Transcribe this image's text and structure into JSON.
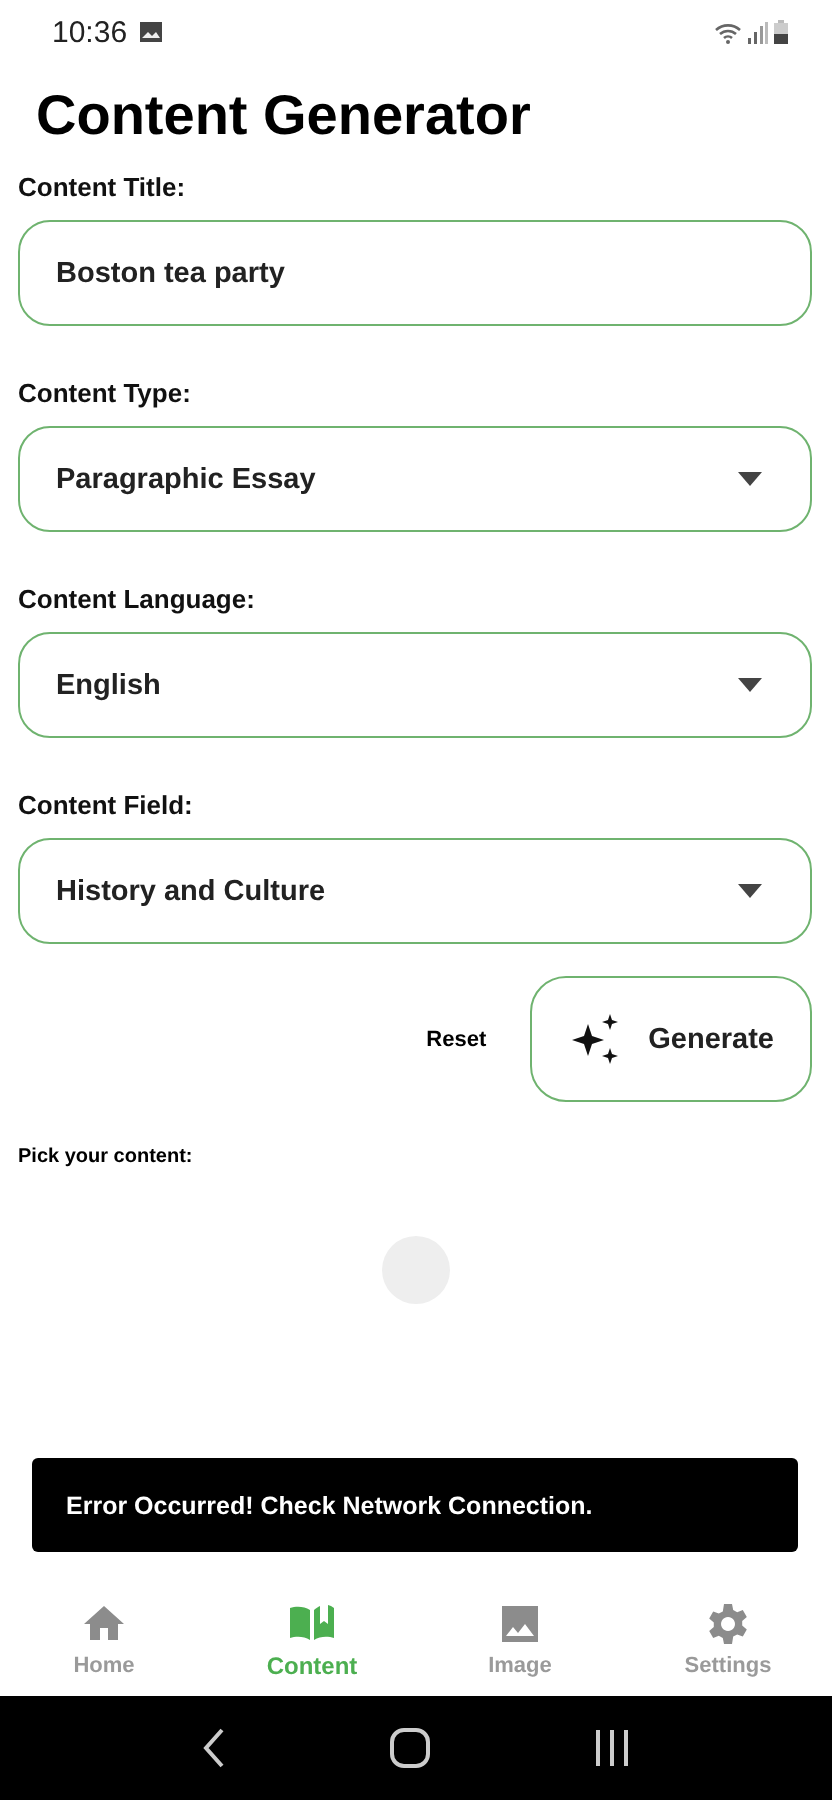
{
  "status_bar": {
    "time": "10:36"
  },
  "title": "Content Generator",
  "fields": [
    {
      "label": "Content Title:",
      "kind": "text",
      "value": "Boston tea party"
    },
    {
      "label": "Content Type:",
      "kind": "dropdown",
      "value": "Paragraphic Essay"
    },
    {
      "label": "Content Language:",
      "kind": "dropdown",
      "value": "English"
    },
    {
      "label": "Content Field:",
      "kind": "dropdown",
      "value": "History and Culture"
    }
  ],
  "actions": {
    "reset": "Reset",
    "generate": "Generate"
  },
  "pick_label": "Pick your content:",
  "snackbar": "Error Occurred! Check Network Connection.",
  "nav": [
    {
      "label": "Home",
      "kind": "home",
      "selected": false
    },
    {
      "label": "Content",
      "kind": "content",
      "selected": true
    },
    {
      "label": "Image",
      "kind": "image",
      "selected": false
    },
    {
      "label": "Settings",
      "kind": "settings",
      "selected": false
    }
  ]
}
